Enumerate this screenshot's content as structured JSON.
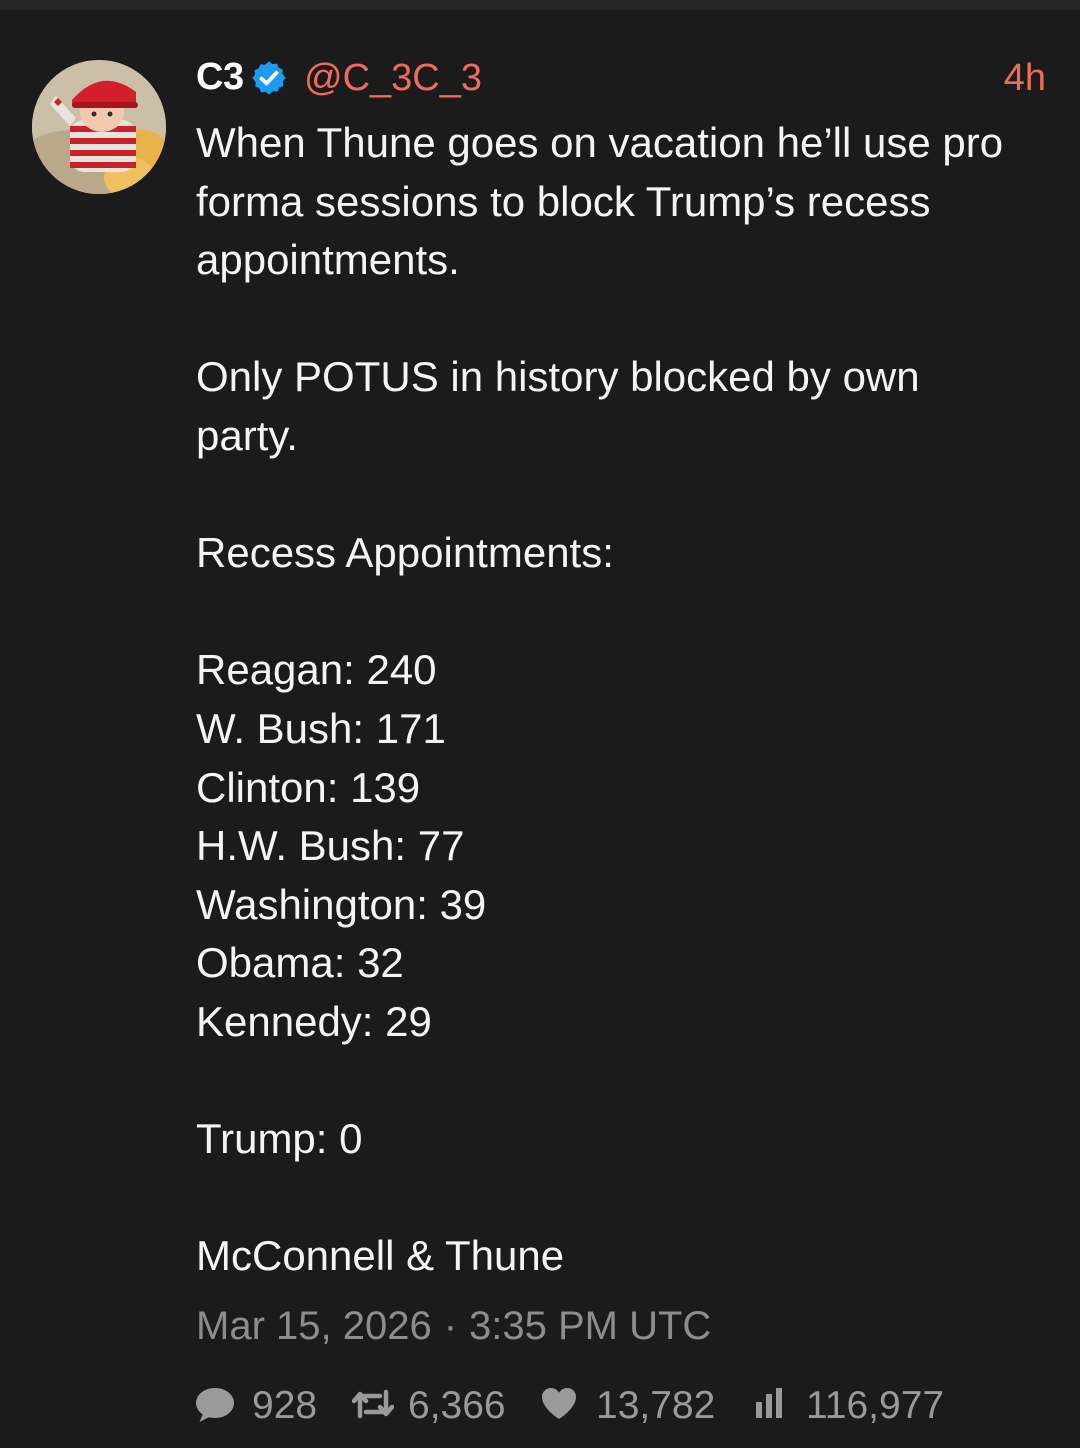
{
  "post": {
    "author": {
      "display_name": "C3",
      "handle": "@C_3C_3",
      "verified": true
    },
    "relative_time": "4h",
    "text_lines": [
      "When Thune goes on vacation he’ll use pro",
      "forma sessions to block Trump’s recess",
      "appointments.",
      "",
      "Only POTUS in history blocked by own",
      "party.",
      "",
      "Recess Appointments:",
      "",
      "Reagan: 240",
      "W. Bush: 171",
      "Clinton: 139",
      "H.W. Bush: 77",
      "Washington: 39",
      "Obama: 32",
      "Kennedy: 29",
      "",
      "Trump: 0",
      "",
      "McConnell & Thune"
    ],
    "date": "Mar 15, 2026",
    "separator": "·",
    "time": "3:35 PM UTC",
    "stats": {
      "replies": "928",
      "reposts": "6,366",
      "likes": "13,782",
      "views": "116,977"
    }
  },
  "colors": {
    "background": "#1b1b1b",
    "accent": "#ef6b5c",
    "verified": "#1d9bf0",
    "muted": "#8d8d8d"
  },
  "icons": {
    "reply": "speech-bubble-icon",
    "repost": "repost-arrows-icon",
    "like": "heart-icon",
    "views": "bar-chart-icon",
    "verified": "verified-check-icon"
  }
}
